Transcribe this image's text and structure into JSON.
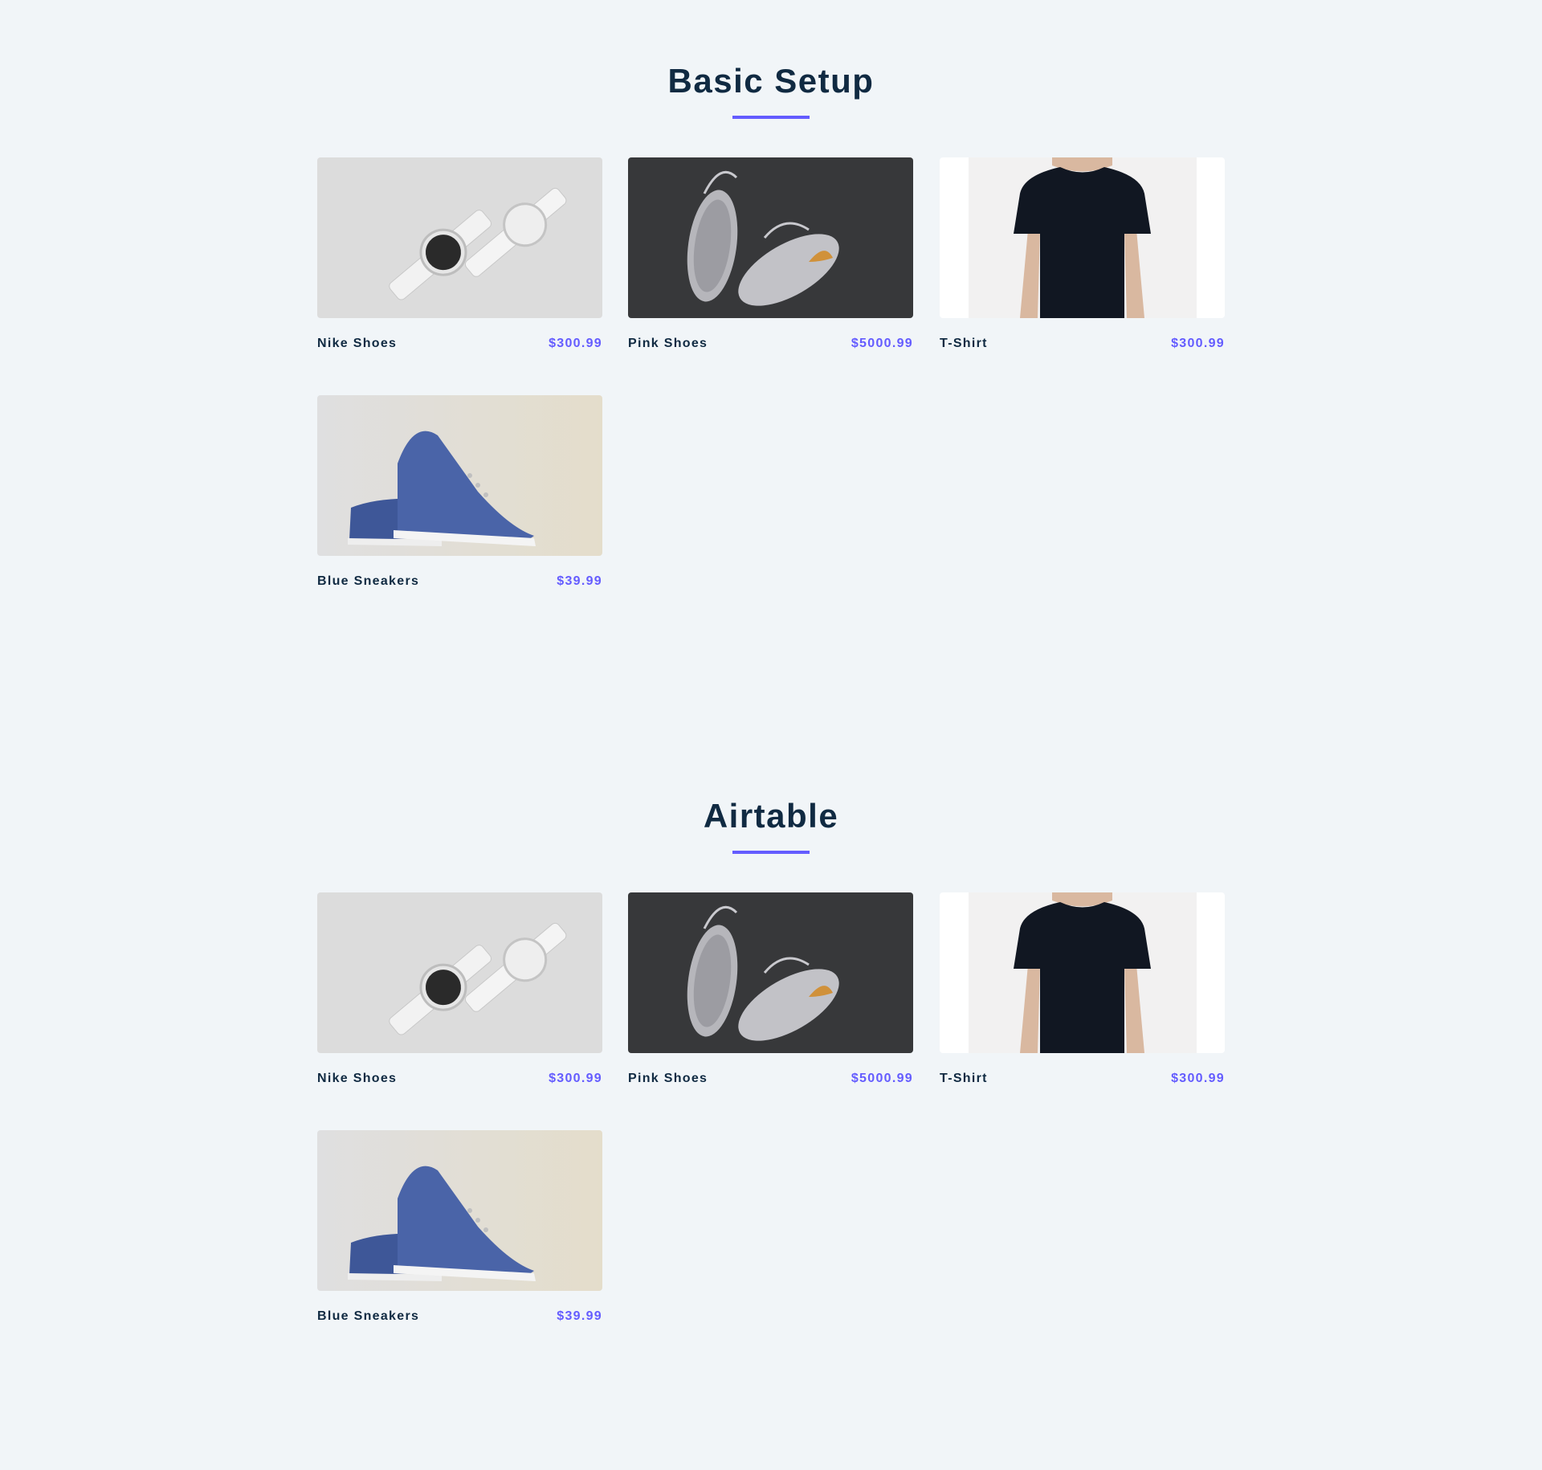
{
  "sections": [
    {
      "title": "Basic Setup",
      "products": [
        {
          "name": "Nike Shoes",
          "price": "$300.99",
          "image": "watches-image"
        },
        {
          "name": "Pink Shoes",
          "price": "$5000.99",
          "image": "sneakers-image"
        },
        {
          "name": "T-Shirt",
          "price": "$300.99",
          "image": "tshirt-image"
        },
        {
          "name": "Blue Sneakers",
          "price": "$39.99",
          "image": "blue-sneakers-image"
        }
      ]
    },
    {
      "title": "Airtable",
      "products": [
        {
          "name": "Nike Shoes",
          "price": "$300.99",
          "image": "watches-image"
        },
        {
          "name": "Pink Shoes",
          "price": "$5000.99",
          "image": "sneakers-image"
        },
        {
          "name": "T-Shirt",
          "price": "$300.99",
          "image": "tshirt-image"
        },
        {
          "name": "Blue Sneakers",
          "price": "$39.99",
          "image": "blue-sneakers-image"
        }
      ]
    }
  ],
  "colors": {
    "background": "#f1f5f8",
    "heading": "#102a42",
    "accent": "#645cff"
  }
}
